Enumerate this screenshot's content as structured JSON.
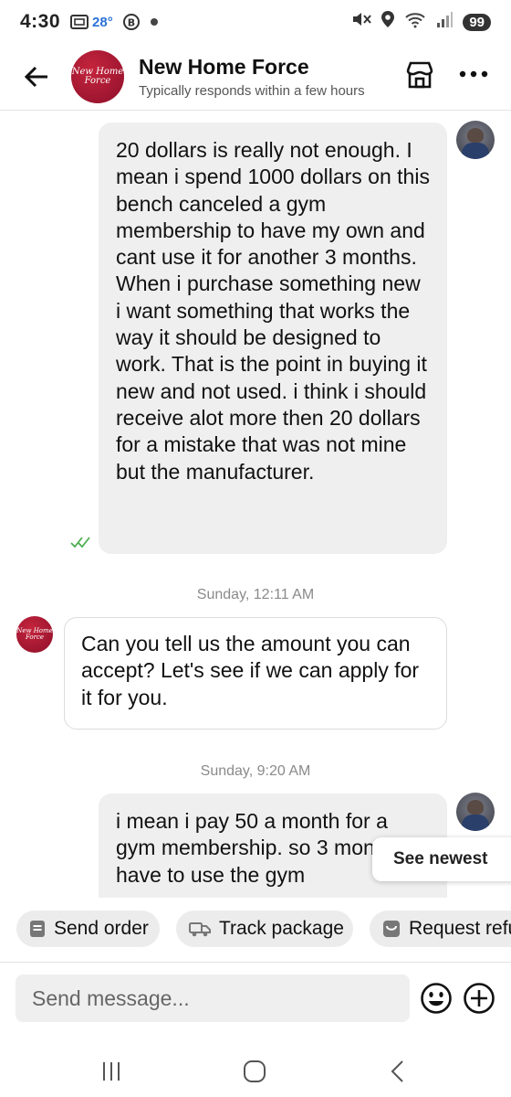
{
  "status_bar": {
    "time": "4:30",
    "temperature": "28°",
    "battery": "99",
    "icons": [
      "screenshot-icon",
      "weather-icon",
      "b-circle-icon",
      "dot-icon",
      "mute-icon",
      "location-icon",
      "wifi-icon",
      "signal-icon"
    ]
  },
  "header": {
    "page_name": "New Home Force",
    "response_time": "Typically responds within a few hours",
    "avatar_text_line1": "New Home",
    "avatar_text_line2": "Force",
    "icons": [
      "back-arrow-icon",
      "shop-icon",
      "more-icon"
    ]
  },
  "messages": [
    {
      "direction": "outgoing",
      "text": "20 dollars is really not enough. I mean i spend 1000 dollars on this bench canceled a gym membership to have my own and cant use it for another 3 months. When i purchase something new i want something that works the way it should be designed to work. That is the point in buying it new and not used. i think i should receive alot more then 20 dollars for a mistake that was not mine but the manufacturer.",
      "status": "seen"
    },
    {
      "direction": "separator",
      "text": "Sunday, 12:11 AM"
    },
    {
      "direction": "incoming",
      "text": "Can you tell us the amount you can accept? Let's see if we can apply for it for you.",
      "avatar_text_line1": "New Home",
      "avatar_text_line2": "Force"
    },
    {
      "direction": "separator",
      "text": "Sunday, 9:20 AM"
    },
    {
      "direction": "outgoing",
      "text": "i mean i pay 50 a month for a gym membership. so 3 months i have to use the gym"
    }
  ],
  "see_newest": "See newest",
  "quick_actions": [
    {
      "label": "Send order",
      "icon": "receipt-icon"
    },
    {
      "label": "Track package",
      "icon": "truck-icon"
    },
    {
      "label": "Request refu",
      "icon": "refund-icon"
    }
  ],
  "composer": {
    "placeholder": "Send message...",
    "icons": [
      "emoji-icon",
      "plus-icon"
    ]
  },
  "nav_bar": {
    "icons": [
      "recents-icon",
      "home-icon",
      "back-icon"
    ]
  }
}
